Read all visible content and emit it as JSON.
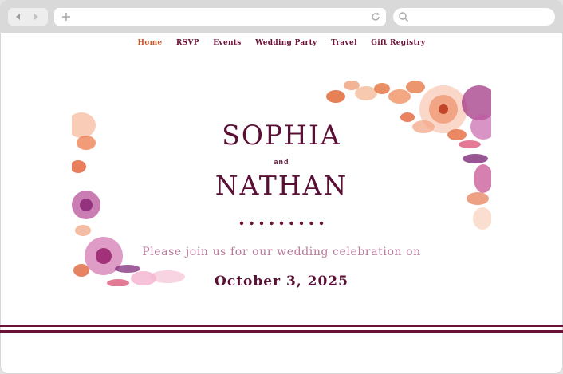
{
  "browser": {
    "url": "",
    "search_placeholder": ""
  },
  "nav": {
    "items": [
      {
        "label": "Home",
        "active": true
      },
      {
        "label": "RSVP",
        "active": false
      },
      {
        "label": "Events",
        "active": false
      },
      {
        "label": "Wedding Party",
        "active": false
      },
      {
        "label": "Travel",
        "active": false
      },
      {
        "label": "Gift Registry",
        "active": false
      }
    ]
  },
  "hero": {
    "first_name": "SOPHIA",
    "conjunction": "and",
    "second_name": "NATHAN",
    "invite_text": "Please join us for our wedding celebration on",
    "date": "October 3, 2025"
  },
  "colors": {
    "burgundy": "#5a0f35",
    "nav_active": "#c65a2e",
    "invite_text": "#b7799a"
  },
  "icons": [
    "back-arrow-icon",
    "forward-arrow-icon",
    "plus-icon",
    "reload-icon",
    "search-icon",
    "floral-decoration"
  ]
}
